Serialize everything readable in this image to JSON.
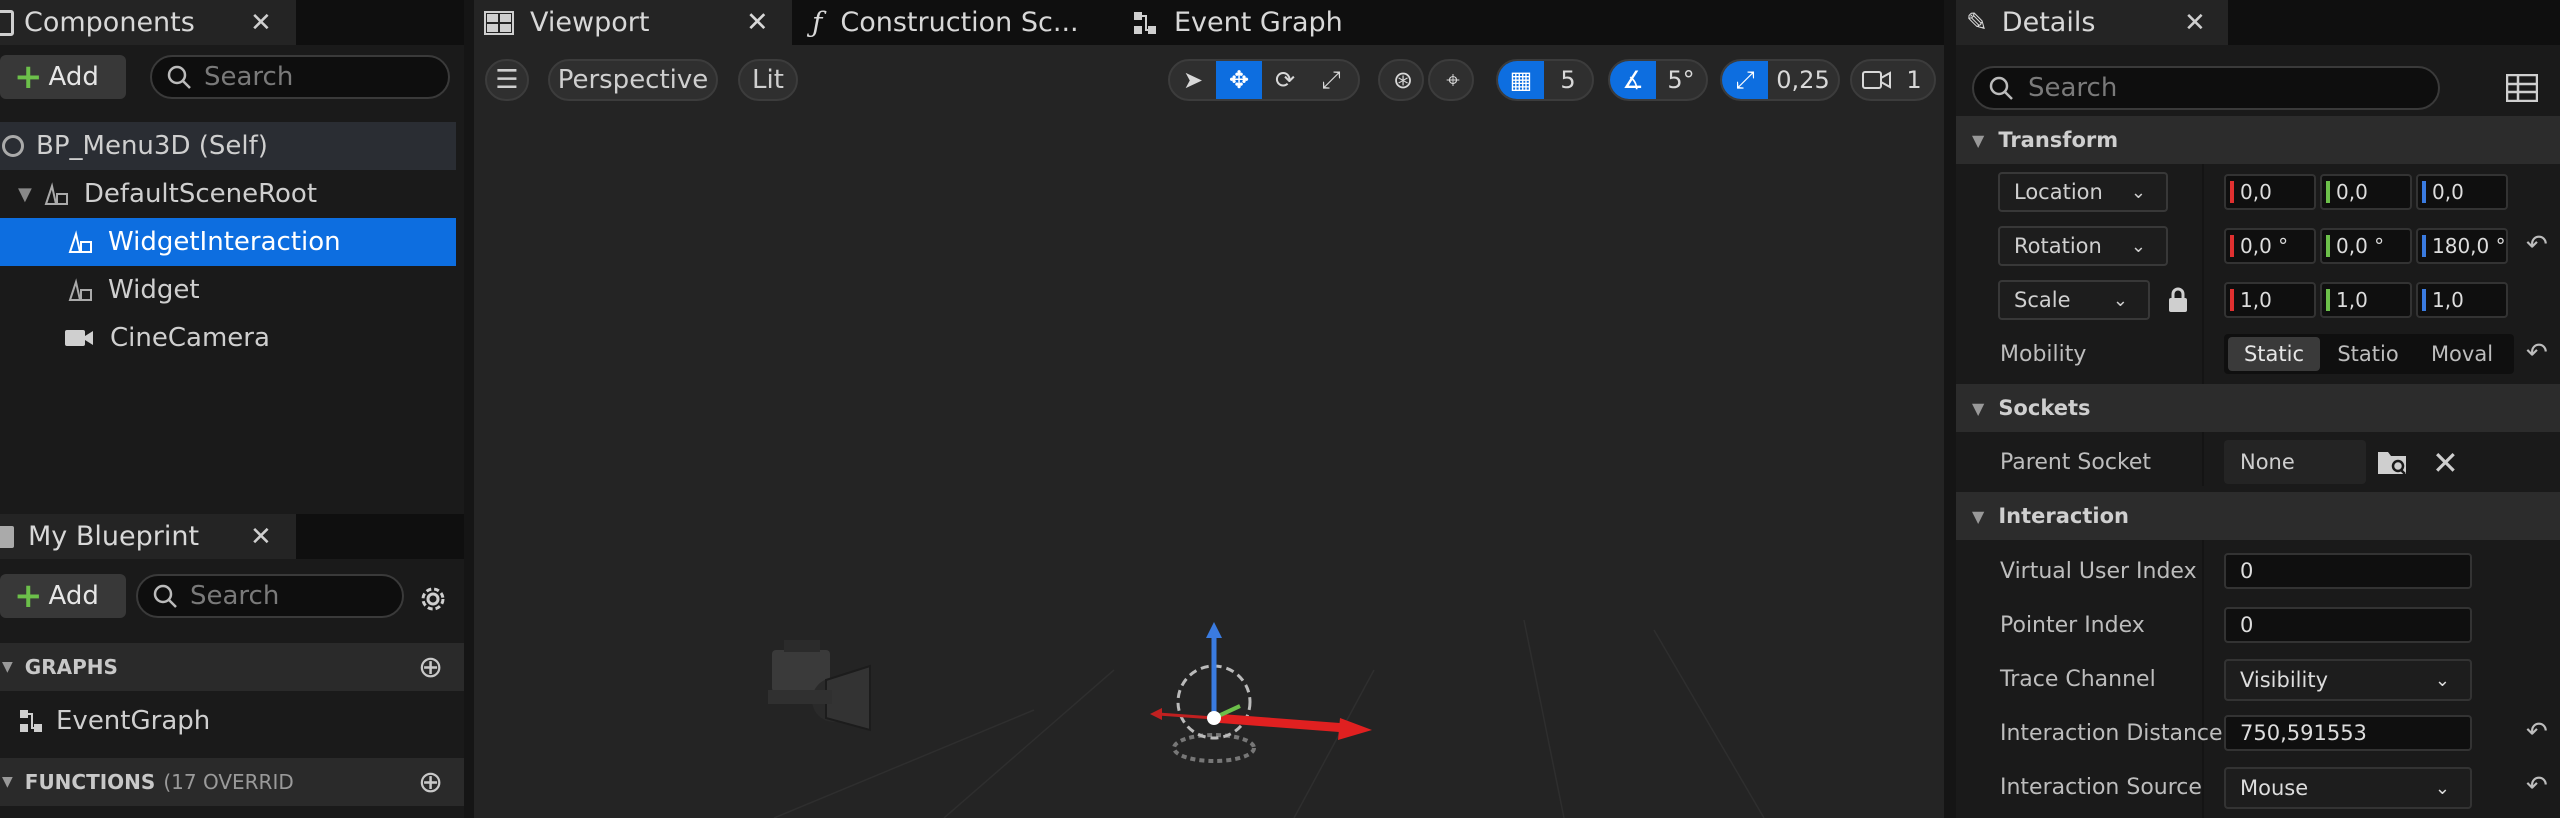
{
  "components_panel": {
    "tab_label": "Components",
    "add_label": "Add",
    "search_placeholder": "Search",
    "tree": [
      {
        "label": "BP_Menu3D (Self)",
        "icon": "blueprint-self-icon"
      },
      {
        "label": "DefaultSceneRoot",
        "icon": "scene-component-icon"
      },
      {
        "label": "WidgetInteraction",
        "icon": "widget-interaction-icon"
      },
      {
        "label": "Widget",
        "icon": "widget-component-icon"
      },
      {
        "label": "CineCamera",
        "icon": "camera-icon"
      }
    ]
  },
  "my_blueprint_panel": {
    "tab_label": "My Blueprint",
    "add_label": "Add",
    "search_placeholder": "Search",
    "graphs_header": "GRAPHS",
    "graph_item": "EventGraph",
    "functions_header": "FUNCTIONS",
    "functions_note": "(17 OVERRID"
  },
  "editor_tabs": [
    "Viewport",
    "Construction Sc...",
    "Event Graph"
  ],
  "viewport_toolbar": {
    "view_mode": "Perspective",
    "lighting": "Lit",
    "grid_snap": "5",
    "rotation_snap": "5°",
    "scale_snap": "0,25",
    "camera_speed": "1"
  },
  "details": {
    "tab_label": "Details",
    "search_placeholder": "Search",
    "transform_header": "Transform",
    "location_label": "Location",
    "location": [
      "0,0",
      "0,0",
      "0,0"
    ],
    "rotation_label": "Rotation",
    "rotation": [
      "0,0 °",
      "0,0 °",
      "180,0 °"
    ],
    "scale_label": "Scale",
    "scale": [
      "1,0",
      "1,0",
      "1,0"
    ],
    "mobility_label": "Mobility",
    "mobility_options": [
      "Static",
      "Statio",
      "Moval"
    ],
    "sockets_header": "Sockets",
    "parent_socket_label": "Parent Socket",
    "parent_socket_value": "None",
    "interaction_header": "Interaction",
    "virtual_user_index_label": "Virtual User Index",
    "virtual_user_index": "0",
    "pointer_index_label": "Pointer Index",
    "pointer_index": "0",
    "trace_channel_label": "Trace Channel",
    "trace_channel": "Visibility",
    "interaction_distance_label": "Interaction Distance",
    "interaction_distance": "750,591553",
    "interaction_source_label": "Interaction Source",
    "interaction_source": "Mouse"
  },
  "colors": {
    "selection": "#0d6ee0",
    "x_axis": "#e03030",
    "y_axis": "#6cc04a",
    "z_axis": "#3a7be0"
  }
}
